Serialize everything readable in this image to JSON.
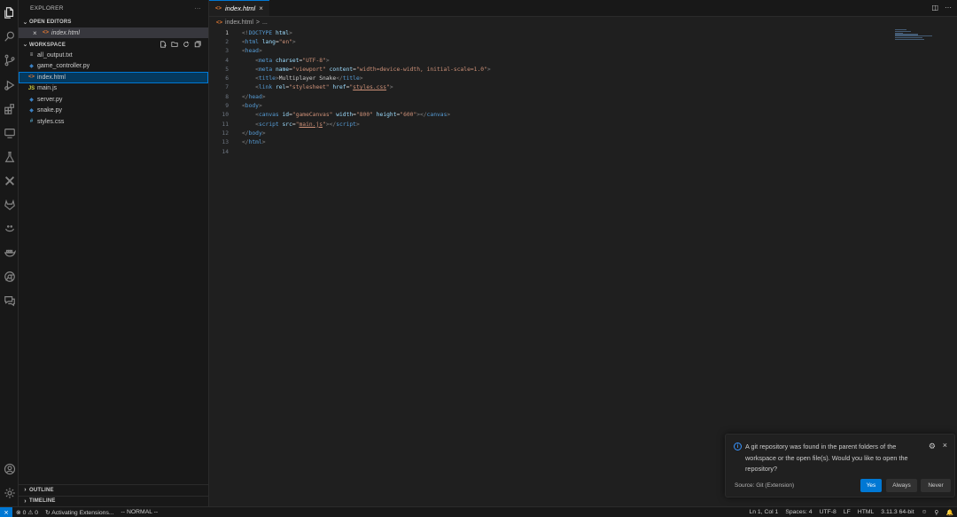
{
  "explorer": {
    "title": "EXPLORER",
    "more": "···",
    "open_editors": {
      "label": "OPEN EDITORS",
      "items": [
        {
          "name": "index.html",
          "icon": "<>"
        }
      ]
    },
    "workspace": {
      "label": "WORKSPACE",
      "files": [
        {
          "name": "all_output.txt",
          "icon": "≡",
          "color": "#cccccc"
        },
        {
          "name": "game_controller.py",
          "icon": "◆",
          "color": "#3b82c4"
        },
        {
          "name": "index.html",
          "icon": "<>",
          "color": "#e37933"
        },
        {
          "name": "main.js",
          "icon": "JS",
          "color": "#cbcb41"
        },
        {
          "name": "server.py",
          "icon": "◆",
          "color": "#3b82c4"
        },
        {
          "name": "snake.py",
          "icon": "◆",
          "color": "#3b82c4"
        },
        {
          "name": "styles.css",
          "icon": "#",
          "color": "#519aba"
        }
      ]
    },
    "outline": "OUTLINE",
    "timeline": "TIMELINE"
  },
  "editor": {
    "tab_label": "index.html",
    "breadcrumb": {
      "file": "index.html",
      "sep": ">",
      "rest": "..."
    },
    "cursor_line": 1,
    "lines": [
      {
        "n": "1",
        "html": "<span class='tgb'>&lt;!</span><span class='tg'>DOCTYPE</span> <span class='at'>html</span><span class='tgb'>&gt;</span>"
      },
      {
        "n": "2",
        "html": "<span class='tgb'>&lt;</span><span class='tg'>html</span> <span class='at'>lang</span>=<span class='st'>\"en\"</span><span class='tgb'>&gt;</span>"
      },
      {
        "n": "3",
        "html": "<span class='tgb'>&lt;</span><span class='tg'>head</span><span class='tgb'>&gt;</span>"
      },
      {
        "n": "4",
        "html": "    <span class='tgb'>&lt;</span><span class='tg'>meta</span> <span class='at'>charset</span>=<span class='st'>\"UTF-8\"</span><span class='tgb'>&gt;</span>"
      },
      {
        "n": "5",
        "html": "    <span class='tgb'>&lt;</span><span class='tg'>meta</span> <span class='at'>name</span>=<span class='st'>\"viewport\"</span> <span class='at'>content</span>=<span class='st'>\"width=device-width, initial-scale=1.0\"</span><span class='tgb'>&gt;</span>"
      },
      {
        "n": "6",
        "html": "    <span class='tgb'>&lt;</span><span class='tg'>title</span><span class='tgb'>&gt;</span>Multiplayer Snake<span class='tgb'>&lt;/</span><span class='tg'>title</span><span class='tgb'>&gt;</span>"
      },
      {
        "n": "7",
        "html": "    <span class='tgb'>&lt;</span><span class='tg'>link</span> <span class='at'>rel</span>=<span class='st'>\"stylesheet\"</span> <span class='at'>href</span>=<span class='st'>\"<span class='ul'>styles.css</span>\"</span><span class='tgb'>&gt;</span>"
      },
      {
        "n": "8",
        "html": "<span class='tgb'>&lt;/</span><span class='tg'>head</span><span class='tgb'>&gt;</span>"
      },
      {
        "n": "9",
        "html": "<span class='tgb'>&lt;</span><span class='tg'>body</span><span class='tgb'>&gt;</span>"
      },
      {
        "n": "10",
        "html": "    <span class='tgb'>&lt;</span><span class='tg'>canvas</span> <span class='at'>id</span>=<span class='st'>\"gameCanvas\"</span> <span class='at'>width</span>=<span class='st'>\"800\"</span> <span class='at'>height</span>=<span class='st'>\"600\"</span><span class='tgb'>&gt;&lt;/</span><span class='tg'>canvas</span><span class='tgb'>&gt;</span>"
      },
      {
        "n": "11",
        "html": "    <span class='tgb'>&lt;</span><span class='tg'>script</span> <span class='at'>src</span>=<span class='st'>\"<span class='ul'>main.js</span>\"</span><span class='tgb'>&gt;&lt;/</span><span class='tg'>script</span><span class='tgb'>&gt;</span>"
      },
      {
        "n": "12",
        "html": "<span class='tgb'>&lt;/</span><span class='tg'>body</span><span class='tgb'>&gt;</span>"
      },
      {
        "n": "13",
        "html": "<span class='tgb'>&lt;/</span><span class='tg'>html</span><span class='tgb'>&gt;</span>"
      },
      {
        "n": "14",
        "html": ""
      }
    ]
  },
  "notification": {
    "message": "A git repository was found in the parent folders of the workspace or the open file(s). Would you like to open the repository?",
    "source": "Source: Git (Extension)",
    "buttons": {
      "yes": "Yes",
      "always": "Always",
      "never": "Never"
    }
  },
  "status": {
    "errors": "0",
    "warnings": "0",
    "activity": "Activating Extensions...",
    "mode": "-- NORMAL --",
    "position": "Ln 1, Col 1",
    "spaces": "Spaces: 4",
    "encoding": "UTF-8",
    "eol": "LF",
    "language": "HTML",
    "python": "3.11.3 64-bit"
  }
}
